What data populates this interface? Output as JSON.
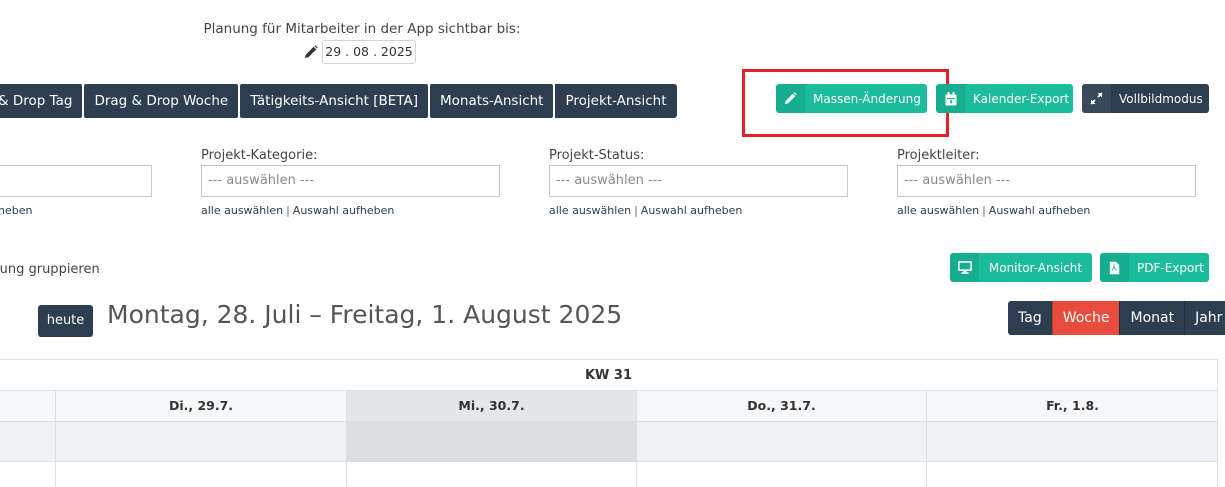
{
  "visibility": {
    "label": "Planung für Mitarbeiter in der App sichtbar bis:",
    "date": "29 . 08 . 2025"
  },
  "view_tabs": [
    "& Drop Tag",
    "Drag & Drop Woche",
    "Tätigkeits-Ansicht [BETA]",
    "Monats-Ansicht",
    "Projekt-Ansicht"
  ],
  "actions": {
    "massen": "Massen-Änderung",
    "kalender": "Kalender-Export",
    "vollbild": "Vollbildmodus",
    "monitor": "Monitor-Ansicht",
    "pdf": "PDF-Export"
  },
  "filters": {
    "partial_link": "heben",
    "kategorie": {
      "label": "Projekt-Kategorie:",
      "placeholder": "--- auswählen ---",
      "select_all": "alle auswählen",
      "clear": "Auswahl aufheben"
    },
    "status": {
      "label": "Projekt-Status:",
      "placeholder": "--- auswählen ---",
      "select_all": "alle auswählen",
      "clear": "Auswahl aufheben"
    },
    "leiter": {
      "label": "Projektleiter:",
      "placeholder": "--- auswählen ---",
      "select_all": "alle auswählen",
      "clear": "Auswahl aufheben"
    }
  },
  "group_label": "lung gruppieren",
  "calendar": {
    "today_label": "heute",
    "range_title": "Montag, 28. Juli – Freitag, 1. August 2025",
    "range_views": [
      "Tag",
      "Woche",
      "Monat",
      "Jahr"
    ],
    "active_view": "Woche",
    "week_label": "KW 31",
    "days": [
      "Di., 29.7.",
      "Mi., 30.7.",
      "Do., 31.7.",
      "Fr., 1.8."
    ],
    "today_day": "Mi., 30.7."
  },
  "colors": {
    "dark": "#2c3e50",
    "green": "#1abc9c",
    "active_red": "#e74c3c",
    "highlight": "#e5202a"
  }
}
